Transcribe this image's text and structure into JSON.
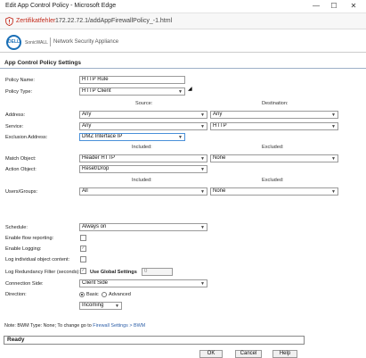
{
  "window": {
    "title": "Edit App Control Policy - Microsoft Edge",
    "minimize": "—",
    "maximize": "☐",
    "close": "✕"
  },
  "address": {
    "cert_label": "Zertifikatfehler",
    "url": "172.22.72.1/addAppFirewallPolicy_-1.html"
  },
  "brand": {
    "logo": "DELL",
    "product": "SonicWALL",
    "subtitle": "Network Security Appliance"
  },
  "page": {
    "title": "App Control Policy Settings"
  },
  "fields": {
    "policy_name": {
      "label": "Policy Name:",
      "value": "HTTP Rule"
    },
    "policy_type": {
      "label": "Policy Type:",
      "value": "HTTP Client"
    },
    "source_header": "Source:",
    "destination_header": "Destination:",
    "address": {
      "label": "Address:",
      "source": "Any",
      "destination": "Any"
    },
    "service": {
      "label": "Service:",
      "source": "Any",
      "destination": "HTTP"
    },
    "exclusion_address": {
      "label": "Exclusion Address:",
      "value": "DMZ Interface IP"
    },
    "included_header": "Included:",
    "excluded_header": "Excluded:",
    "match_object": {
      "label": "Match Object:",
      "included": "Header HTTP",
      "excluded": "None"
    },
    "action_object": {
      "label": "Action Object:",
      "value": "Reset/Drop"
    },
    "users_included_header": "Included:",
    "users_excluded_header": "Excluded:",
    "users_groups": {
      "label": "Users/Groups:",
      "included": "All",
      "excluded": "None"
    },
    "schedule": {
      "label": "Schedule:",
      "value": "Always on"
    },
    "flow_reporting": {
      "label": "Enable flow reporting:"
    },
    "logging": {
      "label": "Enable Logging:"
    },
    "log_individual": {
      "label": "Log individual object content:"
    },
    "log_redundancy": {
      "label": "Log Redundancy Filter (seconds):",
      "global_label": "Use Global Settings",
      "value": "0"
    },
    "connection_side": {
      "label": "Connection Side:",
      "value": "Client Side"
    },
    "direction": {
      "label": "Direction:",
      "basic": "Basic",
      "advanced": "Advanced",
      "value": "Incoming"
    }
  },
  "note": {
    "prefix": "Note: BWM Type: None; To change go to ",
    "link": "Firewall Settings > BWM"
  },
  "status": "Ready",
  "buttons": {
    "ok": "OK",
    "cancel": "Cancel",
    "help": "Help"
  }
}
